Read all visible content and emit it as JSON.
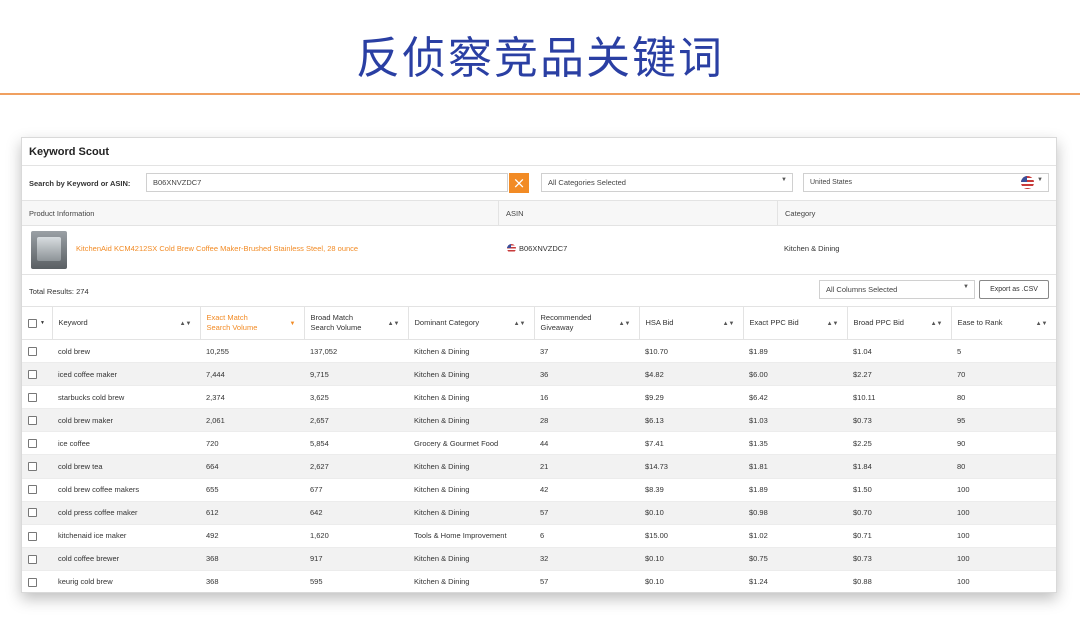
{
  "slide": {
    "title": "反侦察竞品关键词"
  },
  "panel": {
    "title": "Keyword Scout",
    "search_label": "Search by Keyword or ASIN:",
    "search_value": "B06XNVZDC7",
    "clear_icon": "×",
    "category_select": "All Categories Selected",
    "country_select": "United States"
  },
  "product": {
    "headers": {
      "info": "Product Information",
      "asin": "ASIN",
      "category": "Category"
    },
    "name": "KitchenAid KCM4212SX Cold Brew Coffee Maker-Brushed Stainless Steel, 28 ounce",
    "asin": "B06XNVZDC7",
    "category": "Kitchen & Dining"
  },
  "results": {
    "total_label": "Total Results:",
    "total_value": "274",
    "columns_select": "All Columns Selected",
    "export_label": "Export as .CSV"
  },
  "table": {
    "headers": [
      {
        "line1": "Keyword",
        "line2": ""
      },
      {
        "line1": "Exact Match",
        "line2": "Search Volume"
      },
      {
        "line1": "Broad Match",
        "line2": "Search Volume"
      },
      {
        "line1": "Dominant Category",
        "line2": ""
      },
      {
        "line1": "Recommended",
        "line2": "Giveaway"
      },
      {
        "line1": "HSA Bid",
        "line2": ""
      },
      {
        "line1": "Exact PPC Bid",
        "line2": ""
      },
      {
        "line1": "Broad PPC Bid",
        "line2": ""
      },
      {
        "line1": "Ease to Rank",
        "line2": ""
      }
    ],
    "rows": [
      [
        "cold brew",
        "10,255",
        "137,052",
        "Kitchen & Dining",
        "37",
        "$10.70",
        "$1.89",
        "$1.04",
        "5"
      ],
      [
        "iced coffee maker",
        "7,444",
        "9,715",
        "Kitchen & Dining",
        "36",
        "$4.82",
        "$6.00",
        "$2.27",
        "70"
      ],
      [
        "starbucks cold brew",
        "2,374",
        "3,625",
        "Kitchen & Dining",
        "16",
        "$9.29",
        "$6.42",
        "$10.11",
        "80"
      ],
      [
        "cold brew maker",
        "2,061",
        "2,657",
        "Kitchen & Dining",
        "28",
        "$6.13",
        "$1.03",
        "$0.73",
        "95"
      ],
      [
        "ice coffee",
        "720",
        "5,854",
        "Grocery & Gourmet Food",
        "44",
        "$7.41",
        "$1.35",
        "$2.25",
        "90"
      ],
      [
        "cold brew tea",
        "664",
        "2,627",
        "Kitchen & Dining",
        "21",
        "$14.73",
        "$1.81",
        "$1.84",
        "80"
      ],
      [
        "cold brew coffee makers",
        "655",
        "677",
        "Kitchen & Dining",
        "42",
        "$8.39",
        "$1.89",
        "$1.50",
        "100"
      ],
      [
        "cold press coffee maker",
        "612",
        "642",
        "Kitchen & Dining",
        "57",
        "$0.10",
        "$0.98",
        "$0.70",
        "100"
      ],
      [
        "kitchenaid ice maker",
        "492",
        "1,620",
        "Tools & Home Improvement",
        "6",
        "$15.00",
        "$1.02",
        "$0.71",
        "100"
      ],
      [
        "cold coffee brewer",
        "368",
        "917",
        "Kitchen & Dining",
        "32",
        "$0.10",
        "$0.75",
        "$0.73",
        "100"
      ],
      [
        "keurig cold brew",
        "368",
        "595",
        "Kitchen & Dining",
        "57",
        "$0.10",
        "$1.24",
        "$0.88",
        "100"
      ]
    ]
  },
  "colors": {
    "accent": "#f28b25",
    "title": "#2a3fa3",
    "rule": "#f0a060"
  }
}
